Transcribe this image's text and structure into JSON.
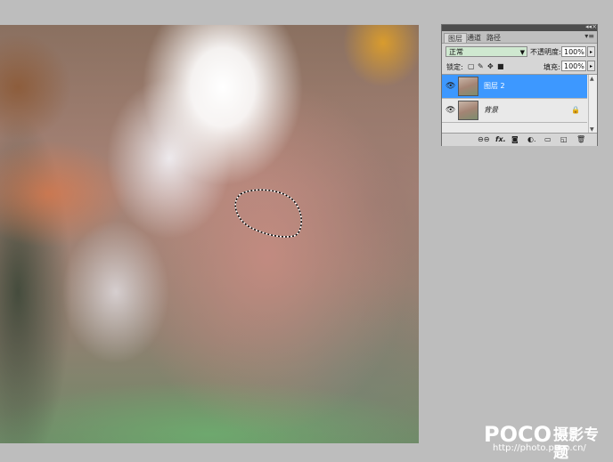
{
  "layers_panel": {
    "tabs": [
      "图层",
      "通道",
      "路径"
    ],
    "blend_mode": "正常",
    "opacity_label": "不透明度:",
    "opacity_value": "100%",
    "lock_label": "锁定:",
    "fill_label": "填充:",
    "fill_value": "100%",
    "layers": [
      {
        "name": "图层 2",
        "selected": true
      },
      {
        "name": "背景",
        "selected": false,
        "locked": true
      }
    ]
  },
  "icons": {
    "eye": "eye-icon",
    "link": "link-layers-icon",
    "fx": "fx-icon",
    "mask": "add-mask-icon",
    "adjustment": "adjustment-layer-icon",
    "group": "new-group-icon",
    "new_layer": "new-layer-icon",
    "trash": "trash-icon"
  },
  "watermark": {
    "logo": "POCO",
    "cn": "摄影专题",
    "url": "http://photo.poco.cn/"
  },
  "colors": {
    "selected_layer": "#3d98ff",
    "blend_mode_bg": "#cfe8d0",
    "workspace_bg": "#bdbdbd"
  }
}
